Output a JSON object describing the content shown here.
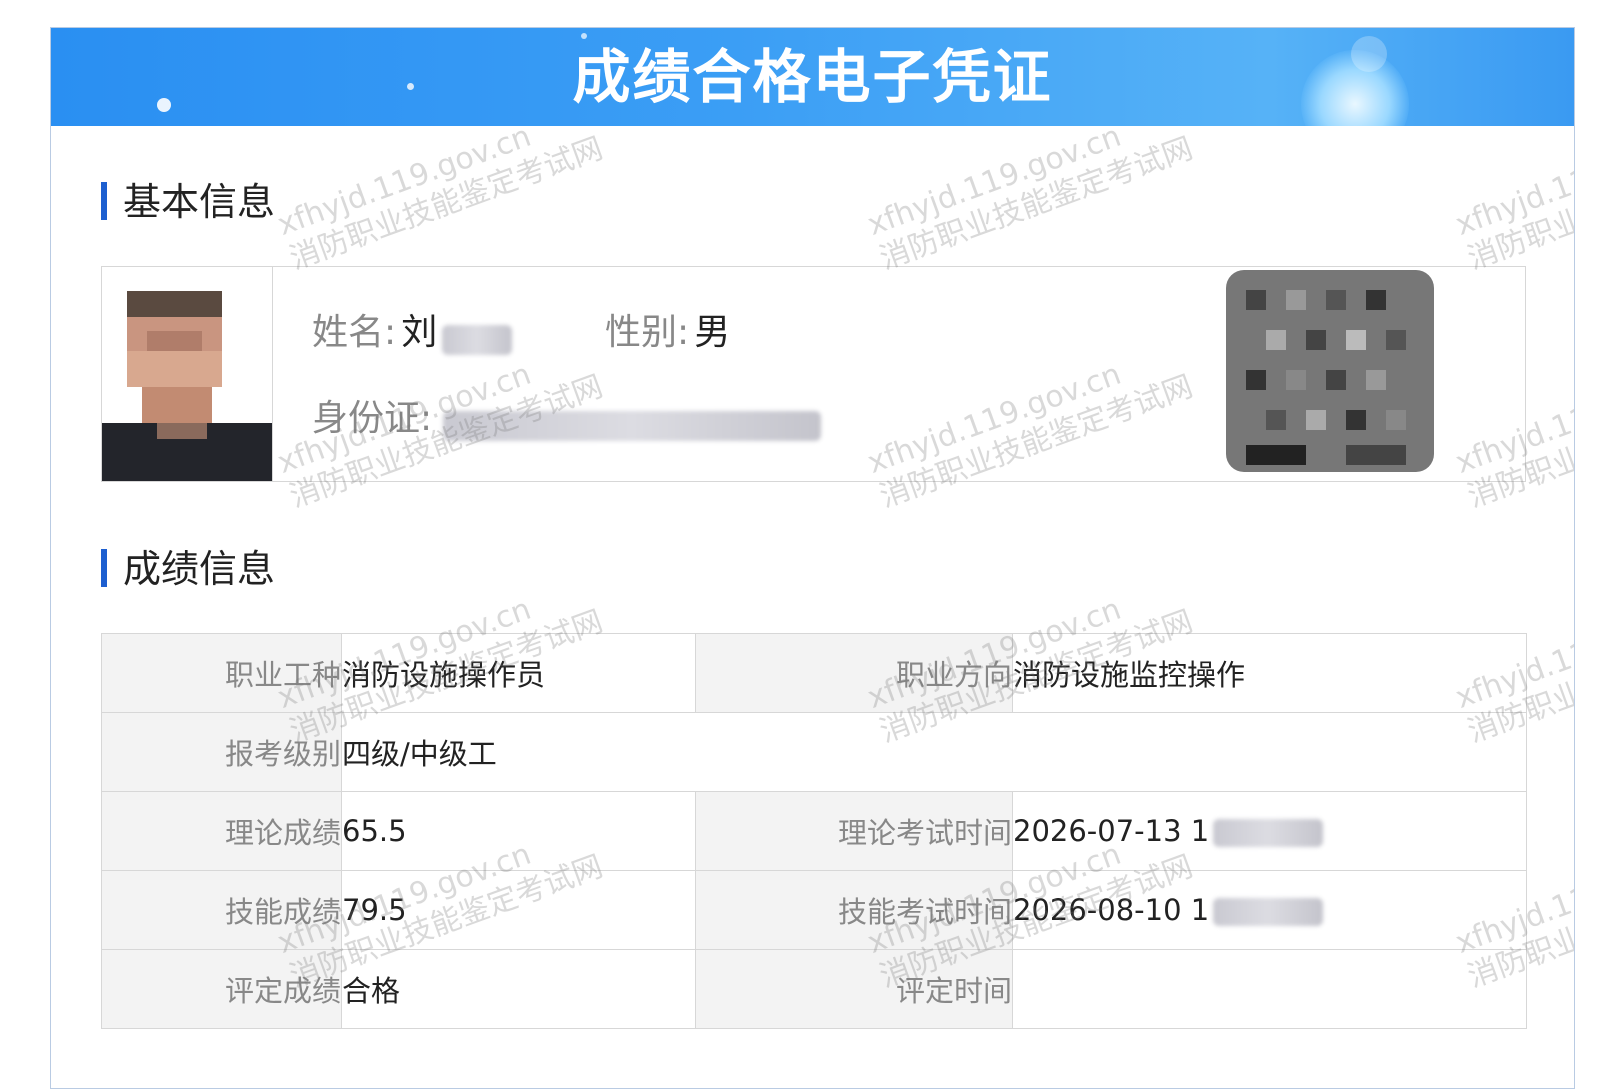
{
  "header": {
    "title": "成绩合格电子凭证"
  },
  "basic": {
    "section_title": "基本信息",
    "name_label": "姓名:",
    "name_value": "刘",
    "gender_label": "性别:",
    "gender_value": "男",
    "id_label": "身份证:"
  },
  "scores": {
    "section_title": "成绩信息",
    "rows": [
      {
        "k1": "职业工种",
        "v1": "消防设施操作员",
        "k2": "职业方向",
        "v2": "消防设施监控操作"
      },
      {
        "k1": "报考级别",
        "v1": "四级/中级工"
      },
      {
        "k1": "理论成绩",
        "v1": "65.5",
        "k2": "理论考试时间",
        "v2": "2026-07-13 1"
      },
      {
        "k1": "技能成绩",
        "v1": "79.5",
        "k2": "技能考试时间",
        "v2": "2026-08-10 1"
      },
      {
        "k1": "评定成绩",
        "v1": "合格",
        "k2": "评定时间",
        "v2": ""
      }
    ]
  },
  "watermark": {
    "line1": "xfhyjd.119.gov.cn",
    "line2": "消防职业技能鉴定考试网"
  },
  "colors": {
    "banner": "#3b9ef5",
    "accent_bar": "#1d5fd0",
    "skill_score": "#2b83e6",
    "pass": "#18a13a"
  }
}
